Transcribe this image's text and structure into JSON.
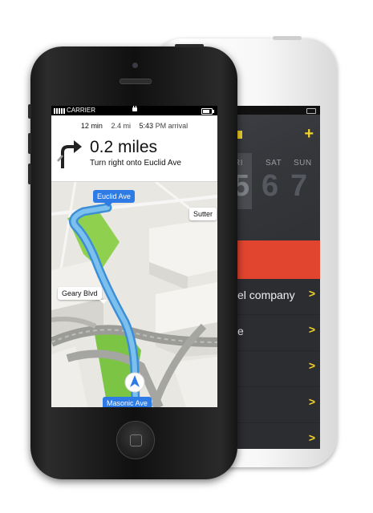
{
  "back_phone": {
    "day_labels": [
      "RI",
      "SAT",
      "SUN"
    ],
    "day_numbers": [
      "5",
      "6",
      "7"
    ],
    "items": [
      {
        "label": "el company"
      },
      {
        "label": "e"
      },
      {
        "label": ""
      },
      {
        "label": ""
      },
      {
        "label": ""
      }
    ],
    "accent_color": "#f4d32a",
    "highlight_color": "#e2452f"
  },
  "status_bar": {
    "carrier": "CARRIER"
  },
  "trip": {
    "duration_value": "12",
    "duration_unit": "min",
    "distance_value": "2.4",
    "distance_unit": "mi",
    "arrival_time": "5:43",
    "arrival_meridiem": "PM",
    "arrival_label": "arrival"
  },
  "maneuver": {
    "distance": "0.2 miles",
    "instruction": "Turn right onto Euclid Ave",
    "icon": "turn-right-arrow-icon"
  },
  "map_labels": {
    "euclid": "Euclid Ave",
    "sutter": "Sutter",
    "geary": "Geary Blvd",
    "masonic": "Masonic Ave"
  },
  "colors": {
    "route": "#5aa7e0",
    "label_blue": "#2e7be6",
    "park_green": "#8fd14f"
  }
}
